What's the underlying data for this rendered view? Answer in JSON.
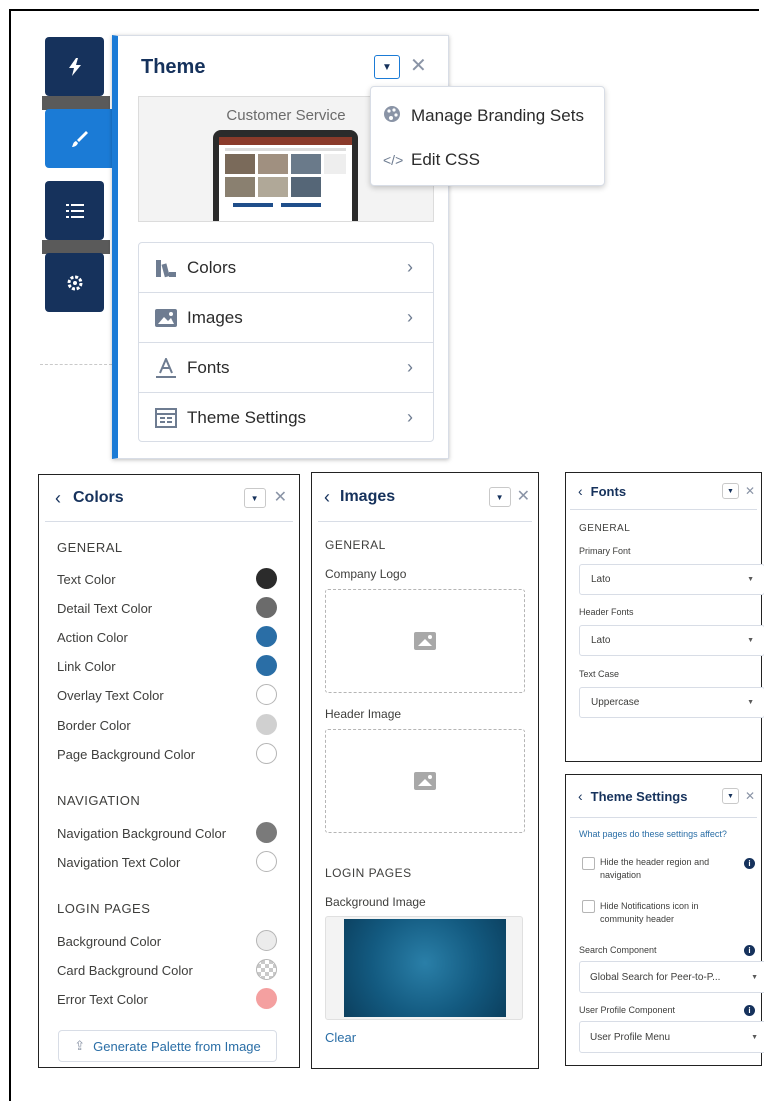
{
  "rail": {
    "icons": [
      "lightning-icon",
      "paintbrush-icon",
      "list-icon",
      "gear-icon"
    ]
  },
  "theme": {
    "title": "Theme",
    "preview_label": "Customer Service",
    "menu": [
      {
        "label": "Colors",
        "icon": "colors-icon"
      },
      {
        "label": "Images",
        "icon": "image-icon"
      },
      {
        "label": "Fonts",
        "icon": "font-icon"
      },
      {
        "label": "Theme Settings",
        "icon": "settings-icon"
      }
    ],
    "dropdown": [
      {
        "label": "Manage Branding Sets",
        "icon": "palette-icon"
      },
      {
        "label": "Edit CSS",
        "icon": "code-icon"
      }
    ]
  },
  "colors": {
    "title": "Colors",
    "general_heading": "GENERAL",
    "general": [
      {
        "label": "Text Color",
        "color": "#2b2b2b"
      },
      {
        "label": "Detail Text Color",
        "color": "#6b6b6b"
      },
      {
        "label": "Action Color",
        "color": "#2a6ea6"
      },
      {
        "label": "Link Color",
        "color": "#2a6ea6"
      },
      {
        "label": "Overlay Text Color",
        "color": "#ffffff"
      },
      {
        "label": "Border Color",
        "color": "#d0d0d0"
      },
      {
        "label": "Page Background Color",
        "color": "#ffffff"
      }
    ],
    "navigation_heading": "NAVIGATION",
    "navigation": [
      {
        "label": "Navigation Background Color",
        "color": "#7a7a7a"
      },
      {
        "label": "Navigation Text Color",
        "color": "#ffffff"
      }
    ],
    "login_heading": "LOGIN PAGES",
    "login": [
      {
        "label": "Background Color",
        "color": "#ececec"
      },
      {
        "label": "Card Background Color",
        "color": "checker"
      },
      {
        "label": "Error Text Color",
        "color": "#f4a0a0"
      }
    ],
    "generate_button": "Generate Palette from Image"
  },
  "images": {
    "title": "Images",
    "general_heading": "GENERAL",
    "company_logo": "Company Logo",
    "header_image": "Header Image",
    "login_heading": "LOGIN PAGES",
    "background_image": "Background Image",
    "clear": "Clear"
  },
  "fonts": {
    "title": "Fonts",
    "general_heading": "GENERAL",
    "primary_font_label": "Primary Font",
    "primary_font": "Lato",
    "header_fonts_label": "Header Fonts",
    "header_fonts": "Lato",
    "text_case_label": "Text Case",
    "text_case": "Uppercase"
  },
  "theme_settings": {
    "title": "Theme Settings",
    "question": "What pages do these settings affect?",
    "hide_header": "Hide the header region and navigation",
    "hide_notifications": "Hide Notifications icon in community header",
    "search_component_label": "Search Component",
    "search_component": "Global Search for Peer-to-P...",
    "user_profile_label": "User Profile Component",
    "user_profile": "User Profile Menu"
  }
}
